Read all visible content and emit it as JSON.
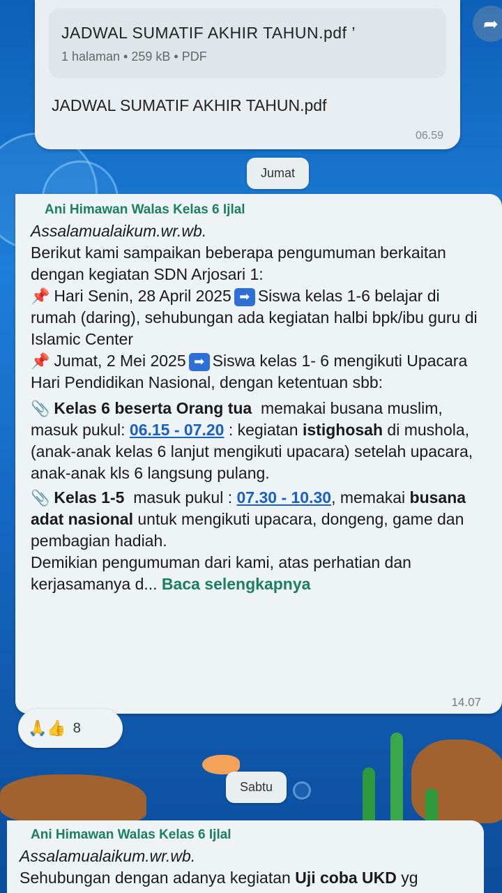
{
  "document_message": {
    "file_name": "JADWAL SUMATIF AKHIR TAHUN.pdf ’",
    "file_meta": "1 halaman • 259 kB • PDF",
    "caption": "JADWAL SUMATIF AKHIR TAHUN.pdf",
    "time": "06.59"
  },
  "date_chips": [
    "Jumat",
    "Sabtu"
  ],
  "announcement": {
    "sender": "Ani Himawan Walas Kelas 6 Ijlal",
    "greeting": "Assalamualaikum.wr.wb.",
    "intro": "Berikut kami sampaikan beberapa pengumuman berkaitan dengan kegiatan SDN Arjosari 1:",
    "item1_date": "Hari Senin, 28 April 2025",
    "item1_text": "Siswa kelas 1-6 belajar di rumah (daring), sehubungan ada kegiatan halbi bpk/ibu guru di Islamic Center",
    "item2_date": "Jumat, 2 Mei 2025",
    "item2_text": "Siswa kelas 1- 6 mengikuti Upacara Hari Pendidikan Nasional, dengan ketentuan sbb:",
    "clip1_bold": "Kelas 6 beserta Orang tua",
    "clip1_text_a": "memakai busana muslim, masuk pukul:",
    "clip1_link": "06.15 - 07.20",
    "clip1_text_b": ": kegiatan",
    "clip1_bold2": "istighosah",
    "clip1_text_c": "di mushola, (anak-anak kelas 6 lanjut mengikuti upacara) setelah upacara, anak-anak kls 6 langsung pulang.",
    "clip2_bold": "Kelas 1-5",
    "clip2_text_a": "masuk pukul :",
    "clip2_link": "07.30 - 10.30",
    "clip2_text_b": ",  memakai",
    "clip2_bold2": "busana adat nasional",
    "clip2_text_c": "untuk mengikuti upacara, dongeng, game dan pembagian hadiah.",
    "closing": "Demikian pengumuman dari kami, atas perhatian dan kerjasamanya d...",
    "read_more": "Baca selengkapnya",
    "time": "14.07"
  },
  "reactions": {
    "emojis": "🙏👍",
    "count": "8"
  },
  "second_message": {
    "sender": "Ani Himawan Walas Kelas 6 Ijlal",
    "greeting": "Assalamualaikum.wr.wb.",
    "text_a": "Sehubungan dengan adanya kegiatan",
    "text_bold": "Uji coba UKD",
    "text_b": "yg"
  },
  "icons": {
    "forward": "forward-icon",
    "pin": "pushpin-icon",
    "arrow": "right-arrow-icon",
    "clip": "paperclip-icon"
  }
}
